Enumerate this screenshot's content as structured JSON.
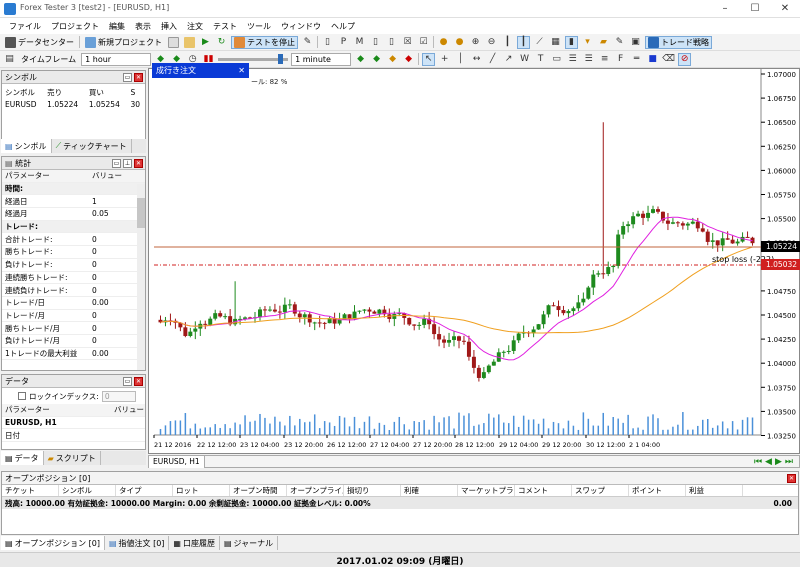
{
  "window": {
    "title": "Forex Tester 3  [test2] - [EURUSD, H1]"
  },
  "menu": [
    "ファイル",
    "プロジェクト",
    "編集",
    "表示",
    "挿入",
    "注文",
    "テスト",
    "ツール",
    "ウィンドウ",
    "ヘルプ"
  ],
  "toolbar1": {
    "data_center": "データセンター",
    "new_project": "新規プロジェクト",
    "stop_test": "テストを停止",
    "trade_strategy": "トレード戦略"
  },
  "toolbar2": {
    "timeframe_label": "タイムフレーム",
    "timeframe_value": "1 hour",
    "speed_value": "1 minute"
  },
  "symbols_panel": {
    "title": "シンボル",
    "columns": [
      "シンボル",
      "売り",
      "買い",
      "S"
    ],
    "rows": [
      [
        "EURUSD",
        "1.05224",
        "1.05254",
        "30"
      ]
    ],
    "tabs": [
      "シンボル",
      "ティックチャート"
    ]
  },
  "stats_panel": {
    "title": "統計",
    "columns": [
      "パラメーター",
      "バリュー"
    ],
    "rows": [
      [
        "時間:",
        ""
      ],
      [
        "経過日",
        "1"
      ],
      [
        "経過月",
        "0.05"
      ],
      [
        "トレード:",
        ""
      ],
      [
        "合計トレード:",
        "0"
      ],
      [
        "勝ちトレード:",
        "0"
      ],
      [
        "負けトレード:",
        "0"
      ],
      [
        "連続勝ちトレード:",
        "0"
      ],
      [
        "連続負けトレード:",
        "0"
      ],
      [
        "トレード/日",
        "0.00"
      ],
      [
        "トレード/月",
        "0"
      ],
      [
        "勝ちトレード/月",
        "0"
      ],
      [
        "負けトレード/月",
        "0"
      ],
      [
        "1トレードの最大利益",
        "0.00"
      ]
    ]
  },
  "data_panel": {
    "title": "データ",
    "lock_label": "ロックインデックス:",
    "lock_value": "0",
    "columns": [
      "パラメーター",
      "バリュー"
    ],
    "rows": [
      [
        "EURUSD, H1",
        ""
      ],
      [
        "日付",
        ""
      ]
    ],
    "tabs": [
      "データ",
      "スクリプト"
    ]
  },
  "chart": {
    "order_popup": "成行き注文",
    "scale_text": "ール: 82 %",
    "tab_label": "EURUSD, H1",
    "price_tag": "1.05224",
    "stop_tag": "1.05032",
    "stop_label": "stop loss (-222)",
    "y_ticks": [
      "1.07000",
      "1.06750",
      "1.06500",
      "1.06250",
      "1.06000",
      "1.05750",
      "1.05500",
      "1.05250",
      "1.05000",
      "1.04750",
      "1.04500",
      "1.04250",
      "1.04000",
      "1.03750",
      "1.03500",
      "1.03250"
    ],
    "x_ticks": [
      "21 12 2016",
      "22 12 12:00",
      "23 12 04:00",
      "23 12 20:00",
      "26 12 12:00",
      "27 12 04:00",
      "27 12 20:00",
      "28 12 12:00",
      "29 12 04:00",
      "29 12 20:00",
      "30 12 12:00",
      "2 1 04:00"
    ],
    "colors": {
      "up": "#1e8a1e",
      "down": "#a01818",
      "ma_fast": "#e020e0",
      "ma_slow": "#f0a020",
      "price_line": "#c0643c",
      "stop_line": "#d02020"
    }
  },
  "positions_panel": {
    "title": "オープンポジション [0]",
    "columns": [
      "チケット",
      "シンボル",
      "タイプ",
      "ロット",
      "オープン時間",
      "オープンプライス",
      "損切り",
      "利確",
      "マーケットプライス",
      "コメント",
      "スワップ",
      "ポイント",
      "利益"
    ],
    "summary": "残高: 10000.00 有効証拠金: 10000.00 Margin: 0.00 余剰証拠金: 10000.00 証拠金レベル: 0.00%",
    "summary_value": "0.00",
    "tabs": [
      "オープンポジション [0]",
      "指値注文 [0]",
      "口座履歴",
      "ジャーナル"
    ]
  },
  "status": {
    "datetime": "2017.01.02 09:09 (月曜日)"
  }
}
